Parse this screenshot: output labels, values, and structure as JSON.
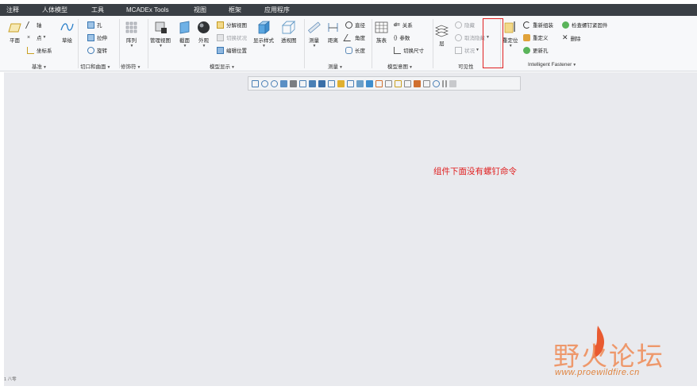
{
  "menu": {
    "tabs": [
      "注释",
      "人体模型",
      "工具",
      "MCADEx Tools",
      "视图",
      "框架",
      "应用程序"
    ]
  },
  "ribbon": {
    "datum": {
      "plane": "平面",
      "axis": "轴",
      "point": "点",
      "csys": "坐标系",
      "sketch": "草绘",
      "label": "基准"
    },
    "cut": {
      "hole": "孔",
      "extrude": "拉伸",
      "revolve": "旋转",
      "label": "切口和曲面"
    },
    "modifier": {
      "pattern": "阵列",
      "label": "修饰符"
    },
    "display": {
      "manage_views": "管理视图",
      "section": "截面",
      "appearance": "外观",
      "explode": "分解视图",
      "toggle_explode": "切换状况",
      "edit_position": "编辑位置",
      "display_style": "显示样式",
      "perspective": "透视图",
      "label": "模型显示"
    },
    "measure": {
      "measure": "测量",
      "distance": "距离",
      "diameter": "直径",
      "angle": "角度",
      "length": "长度",
      "label": "测量"
    },
    "intent": {
      "table": "族表",
      "relations": "关系",
      "relations_prefix": "d=",
      "params": "参数",
      "toggle_dims": "切换尺寸",
      "label": "模型意图"
    },
    "visibility": {
      "layer": "层",
      "hide": "隐藏",
      "unhide": "取消隐藏",
      "status": "状况",
      "label": "可见性"
    },
    "fastener": {
      "reposition": "重定位",
      "restructure": "重新组装",
      "check": "检查螺钉紧固件",
      "redefine": "重定义",
      "delete": "删除",
      "update_hole": "更新孔",
      "label": "Intelligent Fastener"
    }
  },
  "annotation": "组件下面没有螺钉命令",
  "statusline": "1 八零",
  "watermark": {
    "title": "野火论坛",
    "url": "www.proewildfire.cn"
  },
  "colors": {
    "menubar": "#3a3f45",
    "canvas": "#e9eaee",
    "highlight": "#e02020",
    "watermark": "#ef8a55"
  }
}
